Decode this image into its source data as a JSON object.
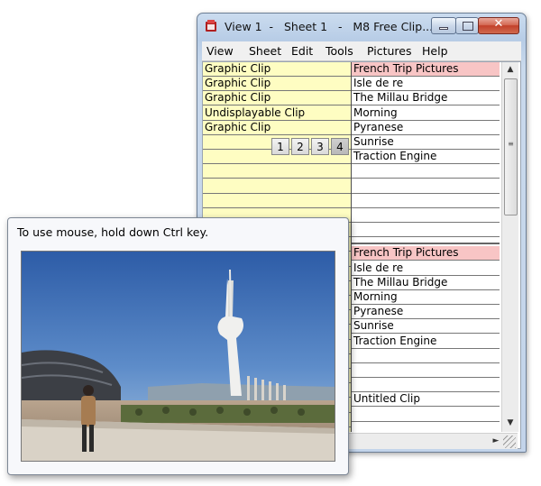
{
  "window": {
    "title": "View 1  -   Sheet 1   -   M8 Free Clip...",
    "controls": {
      "minimize_icon": "minimize-icon",
      "maximize_icon": "maximize-icon",
      "close_glyph": "✕"
    }
  },
  "menu": [
    "View",
    "Sheet",
    "Edit",
    "Tools",
    "Pictures",
    "Help"
  ],
  "left_column": {
    "rows": [
      "Graphic Clip",
      "Graphic Clip",
      "Graphic Clip",
      "Undisplayable Clip",
      "Graphic Clip",
      "",
      "",
      "",
      "",
      "",
      "",
      "",
      "",
      "",
      "",
      "",
      "",
      "",
      "",
      "",
      "",
      "",
      "",
      "",
      ""
    ]
  },
  "right_column": {
    "section1": [
      "French Trip Pictures",
      "Isle de re",
      "The Millau Bridge",
      "Morning",
      "Pyranese",
      "Sunrise",
      "Traction Engine",
      "",
      "",
      "",
      "",
      ""
    ],
    "section2": [
      "French Trip Pictures",
      "Isle de re",
      "The Millau Bridge",
      "Morning",
      "Pyranese",
      "Sunrise",
      "Traction Engine",
      "",
      "",
      "",
      "Untitled Clip",
      ""
    ]
  },
  "pager": {
    "pages": [
      "1",
      "2",
      "3",
      "4"
    ],
    "selected": "4"
  },
  "scrollbar": {
    "up_arrow": "▲",
    "down_arrow": "▼",
    "right_arrow": "►",
    "grip": "≡"
  },
  "tooltip": {
    "text": "To use mouse, hold down Ctrl key.",
    "image_subject": "Photo of tall white telecommunications tower against a blue sky, person in foreground"
  },
  "colors": {
    "left_column_bg": "#fefdc2",
    "header_row_bg": "#f8c5c5",
    "sky_top": "#2f5fa8",
    "sky_bottom": "#8fb2d8"
  }
}
